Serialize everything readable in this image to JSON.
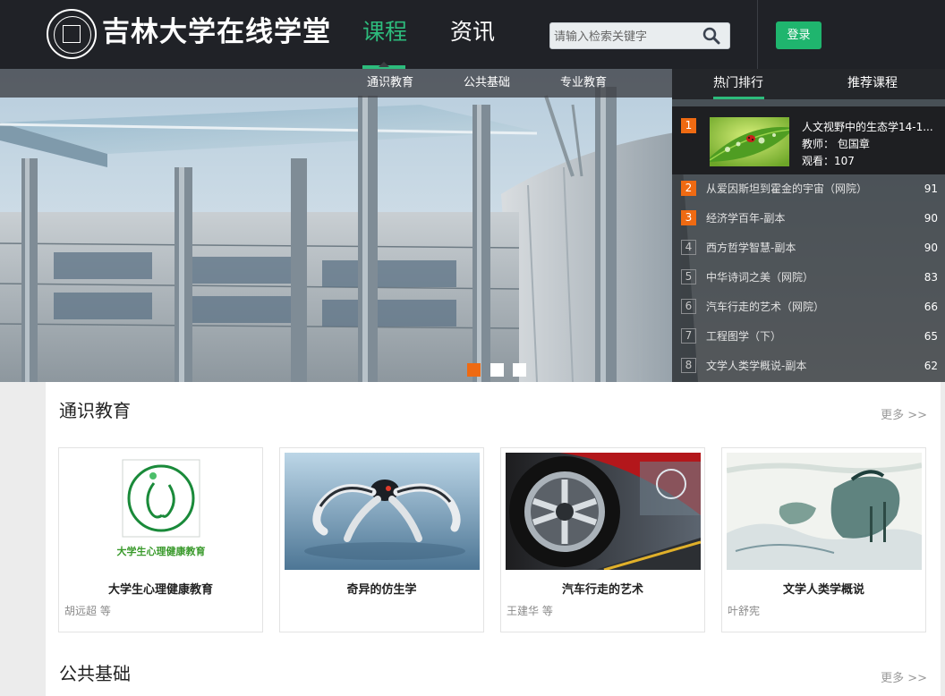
{
  "header": {
    "logo_text": "吉林大学",
    "site_name": "在线学堂",
    "nav": {
      "courses": "课程",
      "news": "资讯"
    },
    "search": {
      "placeholder": "请输入检索关键字"
    },
    "login_label": "登录"
  },
  "subnav": {
    "items": [
      "通识教育",
      "公共基础",
      "专业教育"
    ]
  },
  "banner": {
    "slides": 3,
    "active_slide": 1
  },
  "ranking": {
    "tabs": [
      "热门排行",
      "推荐课程"
    ],
    "active_tab": "热门排行",
    "top": {
      "rank": "1",
      "title": "人文视野中的生态学14-1...",
      "teacher": "教师： 包国章",
      "views": "观看：107"
    },
    "items": [
      {
        "rank": "2",
        "title": "从爱因斯坦到霍金的宇宙（网院）",
        "count": "91",
        "hot": true
      },
      {
        "rank": "3",
        "title": "经济学百年-副本",
        "count": "90",
        "hot": true
      },
      {
        "rank": "4",
        "title": "西方哲学智慧-副本",
        "count": "90",
        "hot": false
      },
      {
        "rank": "5",
        "title": "中华诗词之美（网院）",
        "count": "83",
        "hot": false
      },
      {
        "rank": "6",
        "title": "汽车行走的艺术（网院）",
        "count": "66",
        "hot": false
      },
      {
        "rank": "7",
        "title": "工程图学（下）",
        "count": "65",
        "hot": false
      },
      {
        "rank": "8",
        "title": "文学人类学概说-副本",
        "count": "62",
        "hot": false
      }
    ]
  },
  "sections": [
    {
      "title": "通识教育",
      "more": "更多 >>",
      "cards": [
        {
          "title": "大学生心理健康教育",
          "teacher": "胡远超 等",
          "logo_caption": "大学生心理健康教育"
        },
        {
          "title": "奇异的仿生学",
          "teacher": ""
        },
        {
          "title": "汽车行走的艺术",
          "teacher": "王建华 等"
        },
        {
          "title": "文学人类学概说",
          "teacher": "叶舒宪"
        }
      ]
    },
    {
      "title": "公共基础",
      "more": "更多 >>"
    }
  ],
  "colors": {
    "header_bg": "#202227",
    "accent_green": "#2dbb7c",
    "login_green": "#1fb56e",
    "rank_orange": "#ef6a12"
  }
}
